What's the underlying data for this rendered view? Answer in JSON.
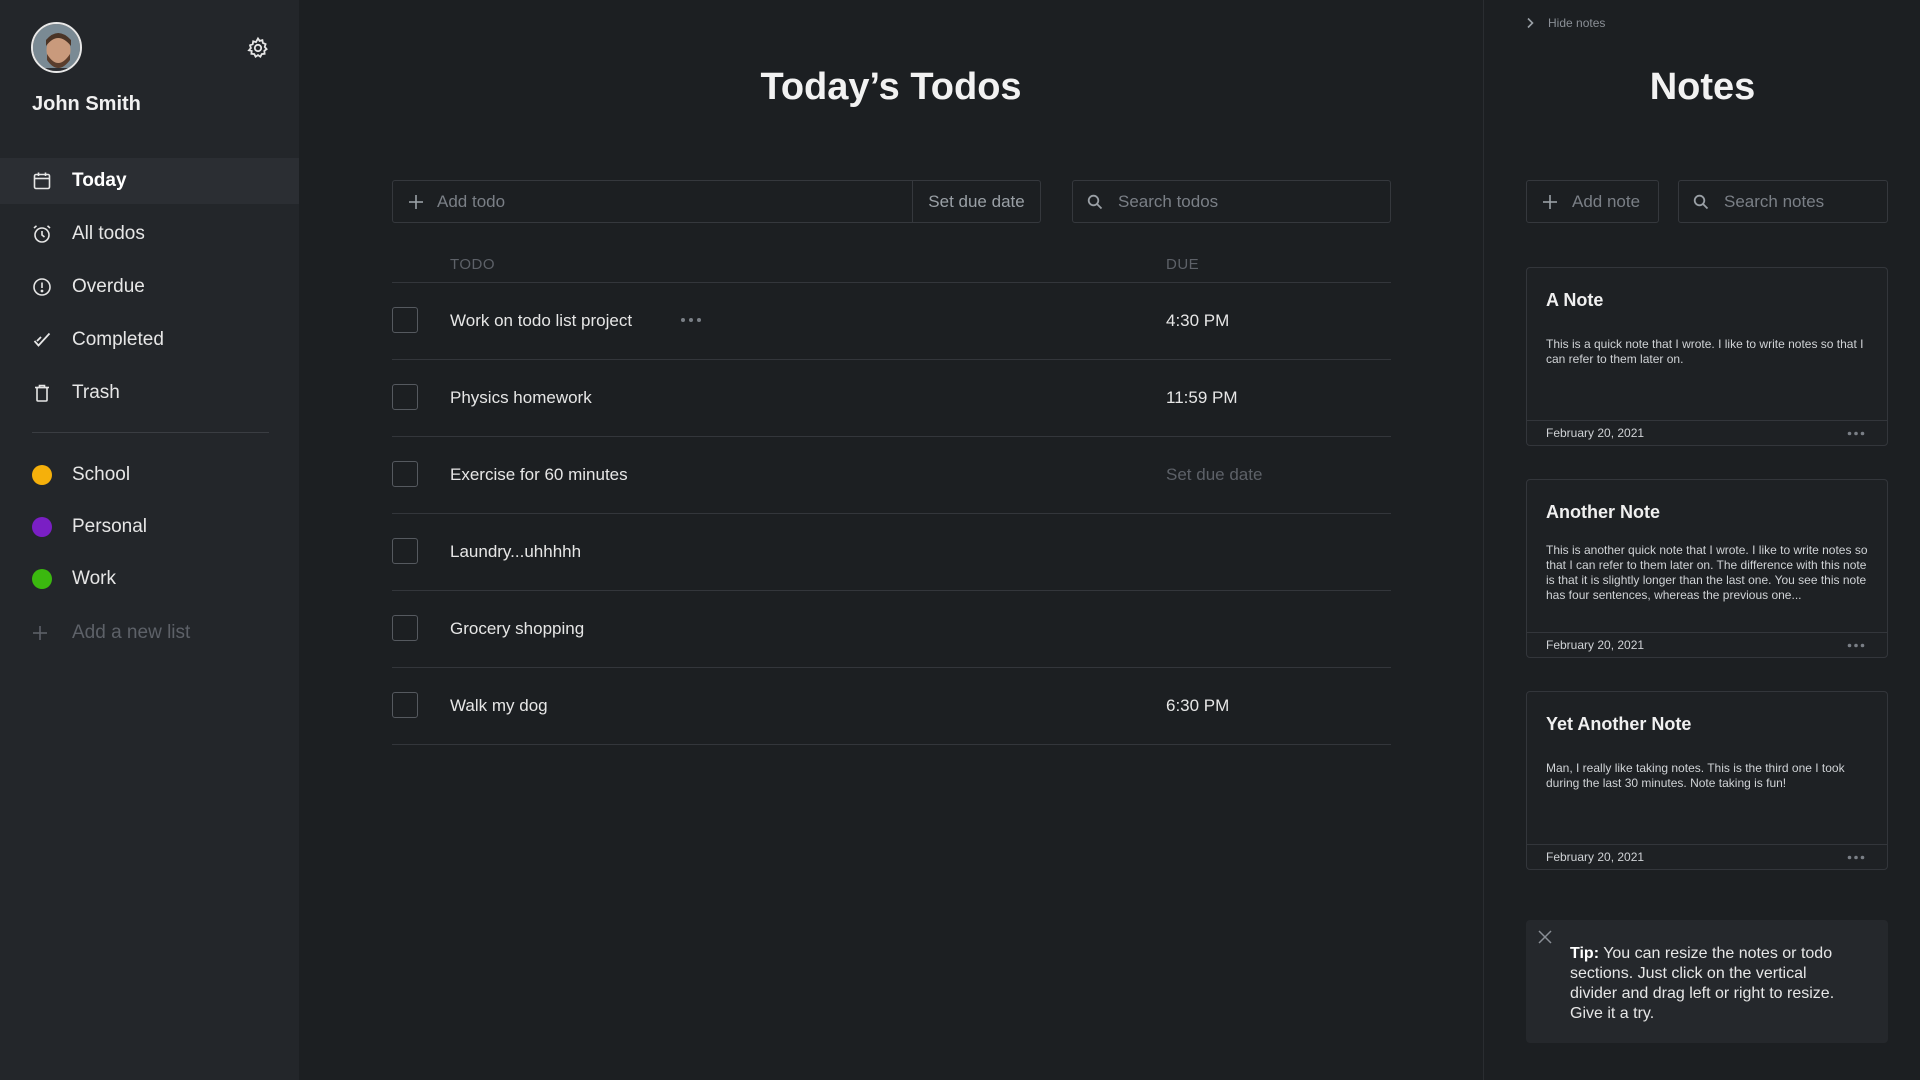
{
  "user": {
    "name": "John Smith"
  },
  "nav": [
    {
      "label": "Today",
      "icon": "calendar-icon",
      "active": true
    },
    {
      "label": "All todos",
      "icon": "alarm-clock-icon"
    },
    {
      "label": "Overdue",
      "icon": "alert-circle-icon"
    },
    {
      "label": "Completed",
      "icon": "checkmark-icon"
    },
    {
      "label": "Trash",
      "icon": "trash-icon"
    }
  ],
  "lists": [
    {
      "label": "School",
      "color": "#f5b00b"
    },
    {
      "label": "Personal",
      "color": "#7a1fc4"
    },
    {
      "label": "Work",
      "color": "#3bb80f"
    }
  ],
  "add_list_label": "Add a new list",
  "main": {
    "title": "Today’s Todos",
    "add_todo_placeholder": "Add todo",
    "set_due_date_label": "Set due date",
    "search_placeholder": "Search todos",
    "col_todo": "TODO",
    "col_due": "DUE",
    "todos": [
      {
        "text": "Work on todo list project",
        "due": "4:30 PM"
      },
      {
        "text": "Physics homework",
        "due": "11:59 PM"
      },
      {
        "text": "Exercise for 60 minutes",
        "due": "Set due date"
      },
      {
        "text": "Laundry...uhhhhh",
        "due": ""
      },
      {
        "text": "Grocery shopping",
        "due": ""
      },
      {
        "text": "Walk my dog",
        "due": "6:30 PM"
      }
    ]
  },
  "notes": {
    "hide_label": "Hide notes",
    "title": "Notes",
    "add_label": "Add note",
    "search_placeholder": "Search notes",
    "items": [
      {
        "title": "A Note",
        "body": "This is a quick note that I wrote. I like to write notes so that I can refer to them later on.",
        "date": "February 20, 2021"
      },
      {
        "title": "Another Note",
        "body": "This is another quick note that I wrote. I like to write notes so that I can refer to them later on. The difference with this note is that it is slightly longer than the last one. You see this note has four sentences, whereas the previous one...",
        "date": "February 20, 2021"
      },
      {
        "title": "Yet Another Note",
        "body": "Man, I really like taking notes. This is the third one I took during the last 30 minutes. Note taking is fun!",
        "date": "February 20, 2021"
      }
    ],
    "tip_label": "Tip:",
    "tip_text": " You can resize the notes or todo sections. Just click on the vertical divider and drag left or right to resize. Give it a try."
  },
  "colors": {
    "background": "#1c1f22",
    "sidebar": "#23262a",
    "text": "#e6e6e6",
    "muted": "#5d6168"
  }
}
